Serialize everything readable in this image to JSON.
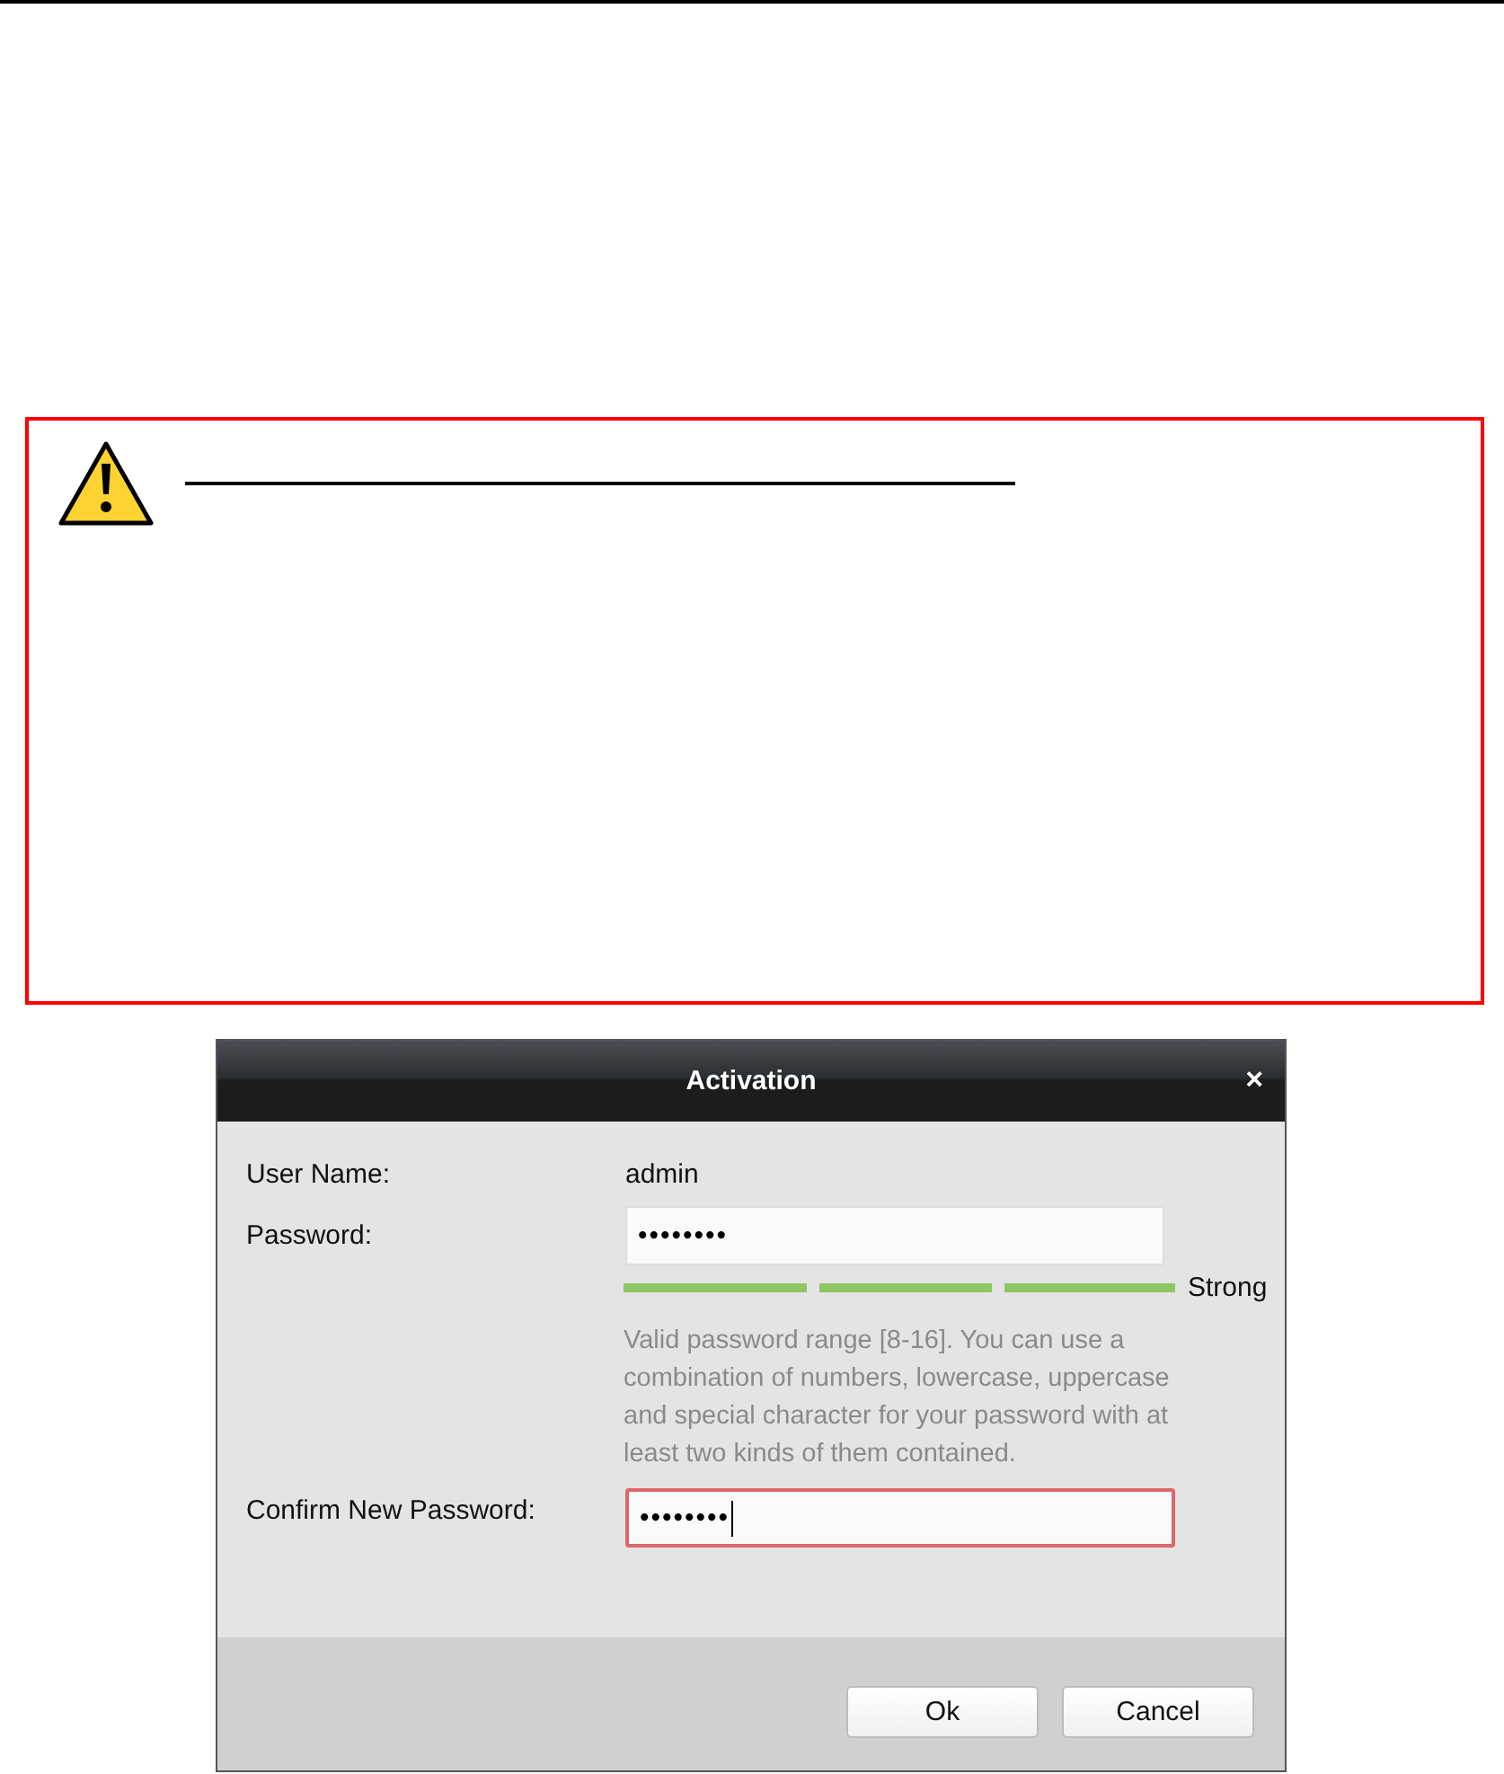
{
  "dialog": {
    "title": "Activation",
    "close": "×",
    "fields": [
      {
        "kind": "text",
        "label": "User Name:",
        "value": "admin"
      },
      {
        "kind": "password",
        "label": "Password:",
        "value": "••••••••",
        "focused": false
      },
      {
        "kind": "strength",
        "level": 1,
        "reading": "Strong"
      },
      {
        "kind": "hint",
        "text": "Valid password range [8-16]. You can use a combination of numbers, lowercase, uppercase and special character for your password with at least two kinds of them contained."
      },
      {
        "kind": "password",
        "label": "Confirm New Password:",
        "value": "••••••••",
        "focused": true
      }
    ],
    "buttons": [
      "Ok",
      "Cancel"
    ]
  }
}
